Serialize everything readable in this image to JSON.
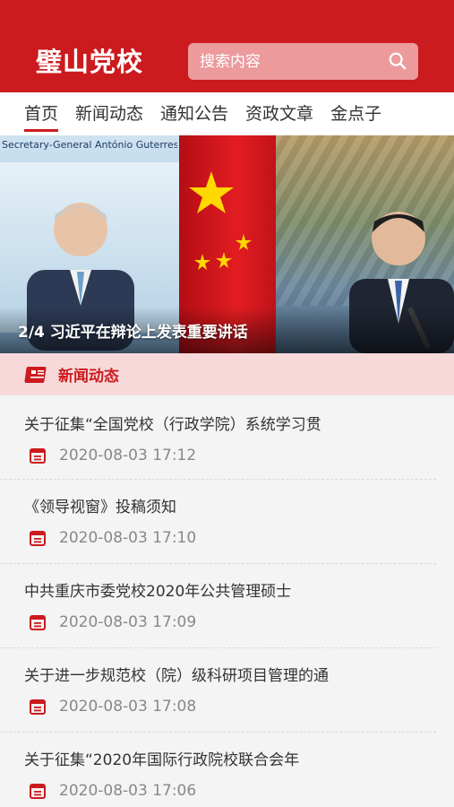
{
  "header": {
    "site_name": "璧山党校",
    "search_placeholder": "搜索内容",
    "search_icon": "search-icon",
    "bg_color": "#cc1b1e"
  },
  "nav": {
    "items": [
      {
        "label": "首页",
        "active": true
      },
      {
        "label": "新闻动态"
      },
      {
        "label": "通知公告"
      },
      {
        "label": "资政文章"
      },
      {
        "label": "金点子"
      }
    ]
  },
  "banner": {
    "caption": "2/4 习近平在辩论上发表重要讲话",
    "image_text": "Secretary-General António Guterres"
  },
  "news_section": {
    "title": "新闻动态",
    "icon": "news-icon",
    "items": [
      {
        "title": "关于征集“全国党校（行政学院）系统学习贯",
        "date": "2020-08-03 17:12"
      },
      {
        "title": "《领导视窗》投稿须知",
        "date": "2020-08-03 17:10"
      },
      {
        "title": "中共重庆市委党校2020年公共管理硕士",
        "date": "2020-08-03 17:09"
      },
      {
        "title": "关于进一步规范校（院）级科研项目管理的通",
        "date": "2020-08-03 17:08"
      },
      {
        "title": "关于征集“2020年国际行政院校联合会年",
        "date": "2020-08-03 17:06"
      }
    ]
  },
  "colors": {
    "accent": "#cc1b1e",
    "section_bg": "#f8d9da",
    "date_text": "#888888"
  }
}
